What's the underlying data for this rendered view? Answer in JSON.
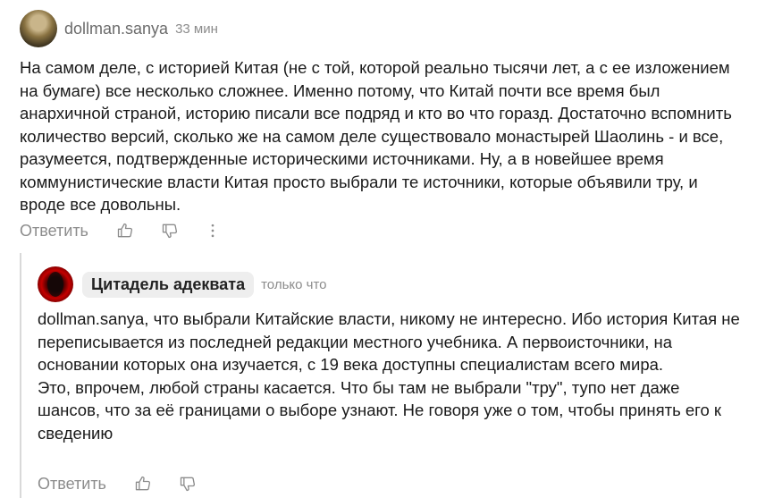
{
  "comment": {
    "author": "dollman.sanya",
    "time": "33 мин",
    "text": "На самом деле, с историей Китая (не с той, которой реально тысячи лет, а с ее изложением на бумаге) все несколько сложнее. Именно потому, что Китай почти все время был анархичной страной, историю писали все подряд и кто во что горазд. Достаточно вспомнить количество версий, сколько же на самом деле существовало монастырей Шаолинь - и все, разумеется, подтвержденные историческими источниками. Ну, а в новейшее время коммунистические власти Китая просто выбрали те источники, которые объявили тру, и вроде все довольны.",
    "actions": {
      "reply_label": "Ответить",
      "like_icon": "thumbs-up-icon",
      "dislike_icon": "thumbs-down-icon",
      "more_icon": "more-vertical-icon"
    }
  },
  "reply": {
    "author": "Цитадель адеквата",
    "time": "только что",
    "paragraph1": "dollman.sanya, что выбрали Китайские власти, никому не интересно. Ибо история Китая не переписывается из последней редакции местного учебника. А первоисточники, на основании которых она изучается, с 19 века доступны специалистам всего мира.",
    "paragraph2": "Это, впрочем, любой страны касается. Что бы там не выбрали \"тру\", тупо нет даже шансов, что за её границами о выборе узнают. Не говоря уже о том, чтобы принять его к сведению",
    "actions": {
      "reply_label": "Ответить",
      "like_icon": "thumbs-up-icon",
      "dislike_icon": "thumbs-down-icon"
    }
  }
}
